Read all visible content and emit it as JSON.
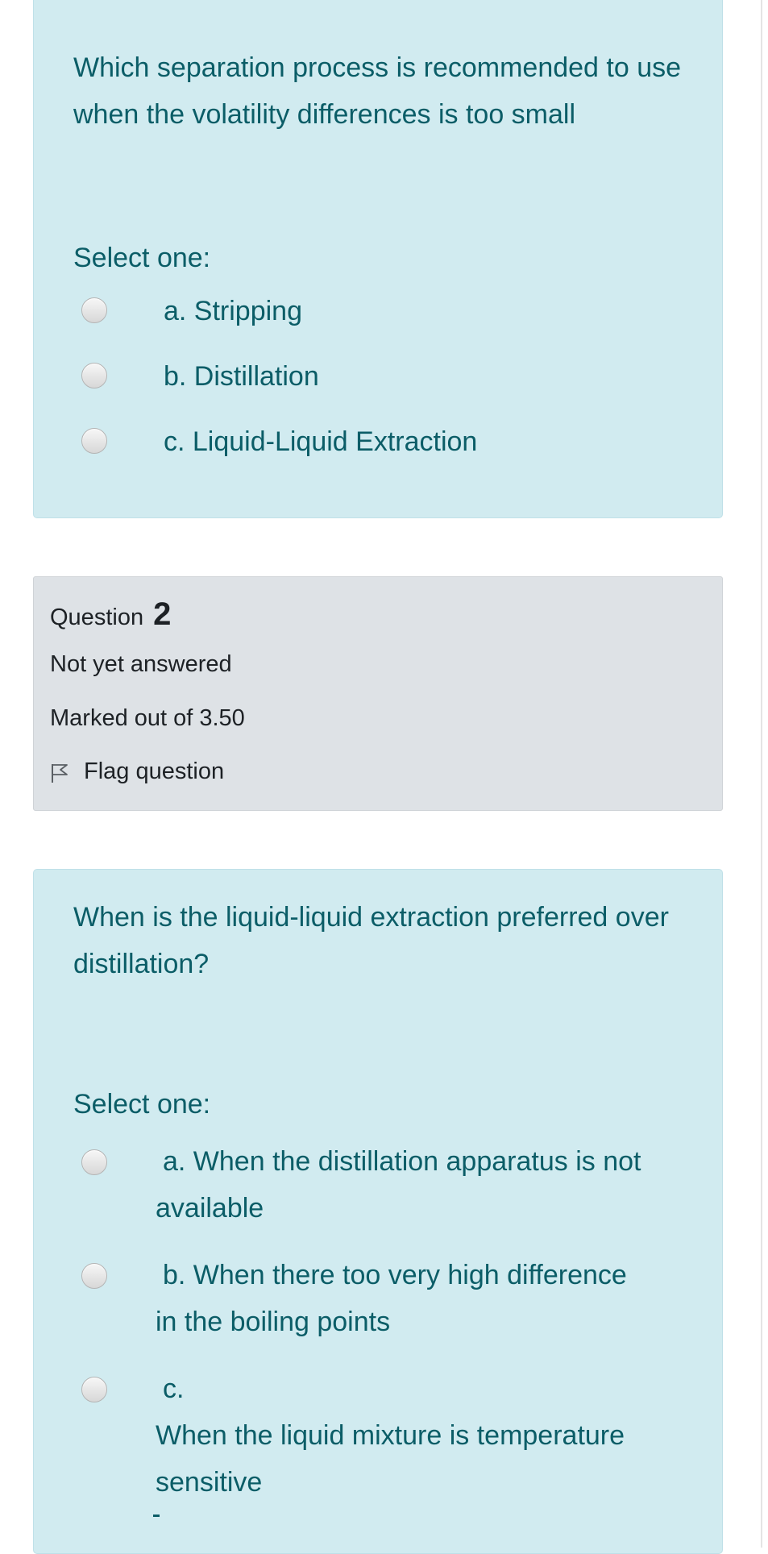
{
  "question1": {
    "text": "Which separation process is recommended to use when the volatility differences is too small",
    "select_label": "Select one:",
    "answers": [
      {
        "label": "a. Stripping"
      },
      {
        "label": "b. Distillation"
      },
      {
        "label": "c. Liquid-Liquid Extraction"
      }
    ]
  },
  "question2_info": {
    "prefix": "Question",
    "number": "2",
    "state": "Not yet answered",
    "grade": "Marked out of 3.50",
    "flag_label": "Flag question",
    "flag_icon": "flag-outline-icon"
  },
  "question2": {
    "text": "When is the liquid-liquid extraction preferred over distillation?",
    "select_label": "Select one:",
    "answers": [
      {
        "line1": "a. When the distillation apparatus is not",
        "line2": "available"
      },
      {
        "line1": "b. When there too very high difference",
        "line2": "in the boiling points"
      },
      {
        "line1": "c.",
        "line2": "When the liquid mixture is temperature",
        "line3": "sensitive"
      }
    ]
  },
  "colors": {
    "question_panel_bg": "#d1ebf0",
    "question_text": "#0b5d67",
    "info_panel_bg": "#dee2e6",
    "info_text": "#1d2125"
  }
}
